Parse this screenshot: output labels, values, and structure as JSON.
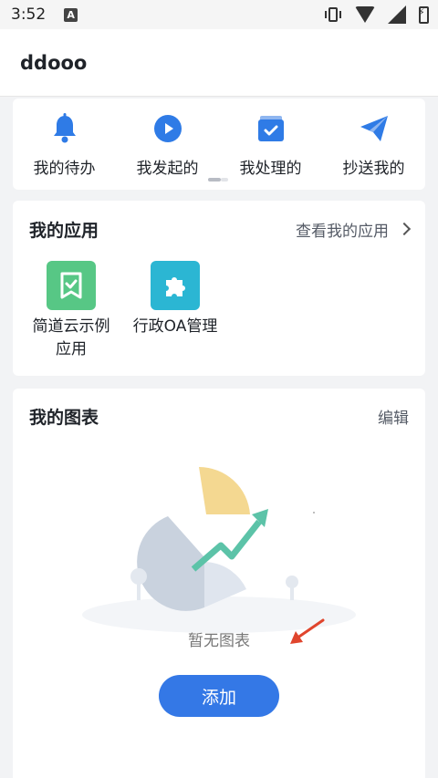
{
  "status_bar": {
    "time": "3:52",
    "a_badge": "A"
  },
  "app_bar": {
    "title": "ddooo"
  },
  "quick_actions": [
    {
      "label": "我的待办",
      "icon": "bell-icon"
    },
    {
      "label": "我发起的",
      "icon": "play-circle-icon"
    },
    {
      "label": "我处理的",
      "icon": "check-calendar-icon"
    },
    {
      "label": "抄送我的",
      "icon": "paper-plane-icon"
    }
  ],
  "my_apps": {
    "title": "我的应用",
    "view_link": "查看我的应用",
    "apps": [
      {
        "name": "简道云示例应用",
        "icon": "bookmark-check-icon",
        "color": "#57c785"
      },
      {
        "name": "行政OA管理",
        "icon": "puzzle-icon",
        "color": "#2bb6d3"
      }
    ]
  },
  "my_charts": {
    "title": "我的图表",
    "edit_label": "编辑",
    "empty_text": "暂无图表",
    "add_label": "添加"
  },
  "colors": {
    "accent": "#3478e6",
    "annotation_arrow": "#e0452d"
  }
}
